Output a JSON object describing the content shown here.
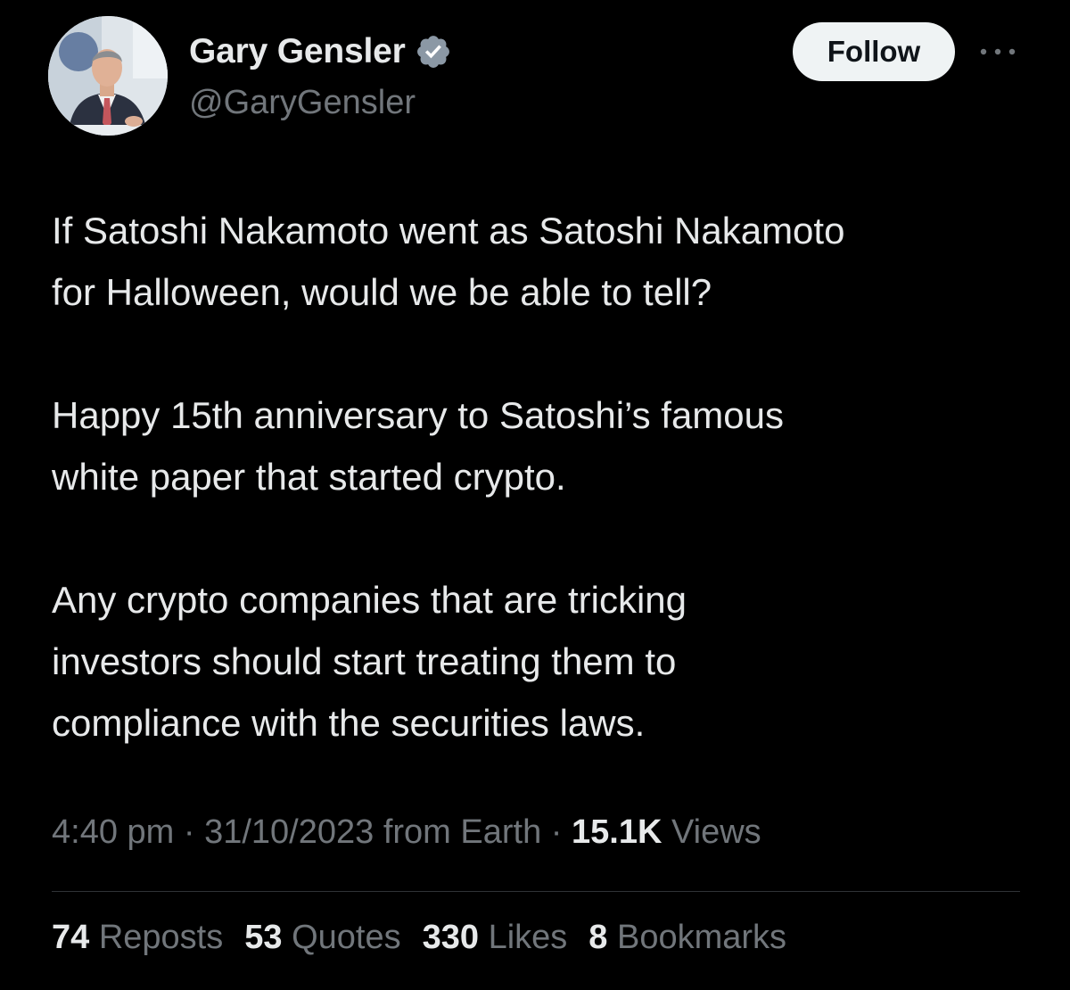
{
  "author": {
    "display_name": "Gary Gensler",
    "handle": "@GaryGensler",
    "avatar_icon": "profile-photo",
    "verified_icon": "verified-badge-icon",
    "verified_color": "#8b98a5"
  },
  "header": {
    "follow_label": "Follow",
    "more_icon": "more-horizontal-icon"
  },
  "tweet": {
    "paragraphs": [
      {
        "lines": [
          "If Satoshi Nakamoto went as Satoshi Nakamoto",
          "for Halloween, would we be able to tell?"
        ]
      },
      {
        "lines": [
          "Happy 15th anniversary to Satoshi’s famous",
          "white paper that started crypto."
        ]
      },
      {
        "lines": [
          "Any crypto companies that are tricking",
          "investors should start treating them to",
          "compliance with the securities laws."
        ]
      }
    ]
  },
  "meta": {
    "time": "4:40 pm",
    "separator": " · ",
    "date": "31/10/2023",
    "source": " from Earth",
    "views_count": "15.1K",
    "views_label": " Views"
  },
  "stats": [
    {
      "count": "74",
      "label": " Reposts"
    },
    {
      "count": "53",
      "label": " Quotes"
    },
    {
      "count": "330",
      "label": " Likes"
    },
    {
      "count": "8",
      "label": " Bookmarks"
    }
  ],
  "colors": {
    "background": "#000000",
    "primary_text": "#e7e9ea",
    "secondary_text": "#71767b",
    "divider": "#2f3336",
    "follow_bg": "#eff3f4"
  }
}
